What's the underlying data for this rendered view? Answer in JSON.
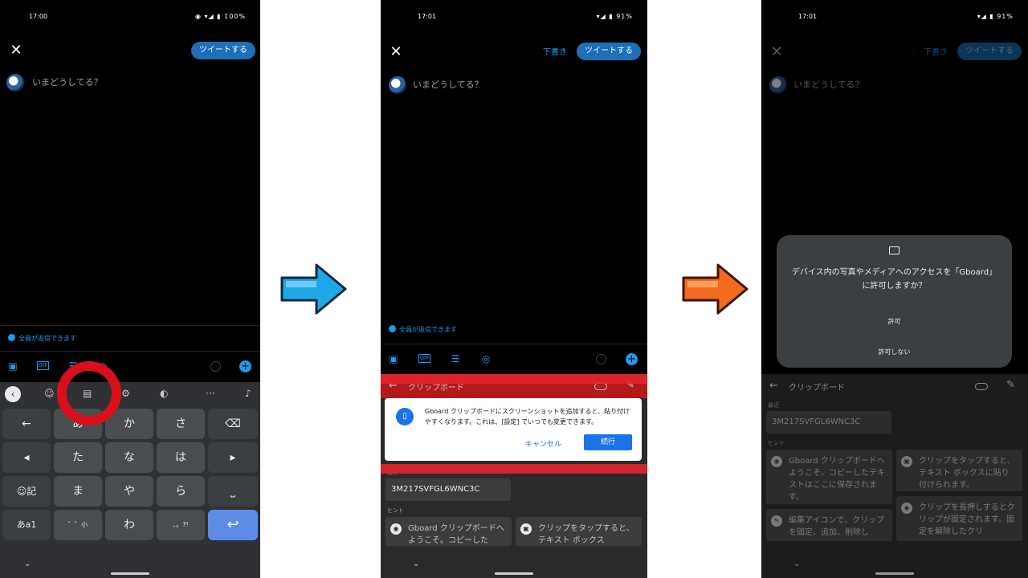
{
  "panel1": {
    "time": "17:00",
    "battery": "100%",
    "close": "✕",
    "tweet_button": "ツイートする",
    "prompt": "いまどうしてる？",
    "reply_setting": "全員が返信できます",
    "keyboard": {
      "row1": [
        "←",
        "あ",
        "か",
        "さ",
        "⌫"
      ],
      "row2": [
        "◂",
        "た",
        "な",
        "は",
        "▸"
      ],
      "row3": [
        "☺記",
        "ま",
        "や",
        "ら",
        "⎵"
      ],
      "row4": [
        "あa1",
        "゛゜小",
        "わ",
        "、。?!",
        "↩"
      ]
    }
  },
  "panel2": {
    "time": "17:01",
    "battery": "91%",
    "close": "✕",
    "draft": "下書き",
    "tweet_button": "ツイートする",
    "prompt": "いまどうしてる？",
    "reply_setting": "全員が返信できます",
    "clipboard_title": "クリップボード",
    "dialog_text": "Gboard クリップボードにスクリーンショットを追加すると、貼り付けやすくなります。これは、[設定] でいつでも変更できます。",
    "cancel": "キャンセル",
    "continue": "続行",
    "recent_label": "最近",
    "clip_item": "3M217SVFGL6WNC3C",
    "hint_label": "ヒント",
    "hint1": "Gboard クリップボードへようこそ。コピーした",
    "hint2": "クリップをタップすると、テキスト ボックス"
  },
  "panel3": {
    "time": "17:01",
    "battery": "91%",
    "draft": "下書き",
    "tweet_button": "ツイートする",
    "prompt": "いまどうしてる？",
    "permission_text": "デバイス内の写真やメディアへのアクセスを「Gboard」に許可しますか？",
    "allow": "許可",
    "deny": "許可しない",
    "clipboard_title": "クリップボード",
    "recent_label": "最近",
    "clip_item": "3M217SVFGL6WNC3C",
    "hint_label": "ヒント",
    "hint1": "Gboard クリップボードへようこそ。コピーしたテキストはここに保存されます。",
    "hint2": "クリップをタップすると、テキスト ボックスに貼り付けられます。",
    "hint3": "編集アイコンで、クリップを固定、追加、削除し",
    "hint4": "クリップを長押しするとクリップが固定されます。固定を解除したクリ"
  },
  "colors": {
    "arrow1": "#1fa8e8",
    "arrow2": "#f26a1b",
    "highlight": "#e3232b"
  }
}
